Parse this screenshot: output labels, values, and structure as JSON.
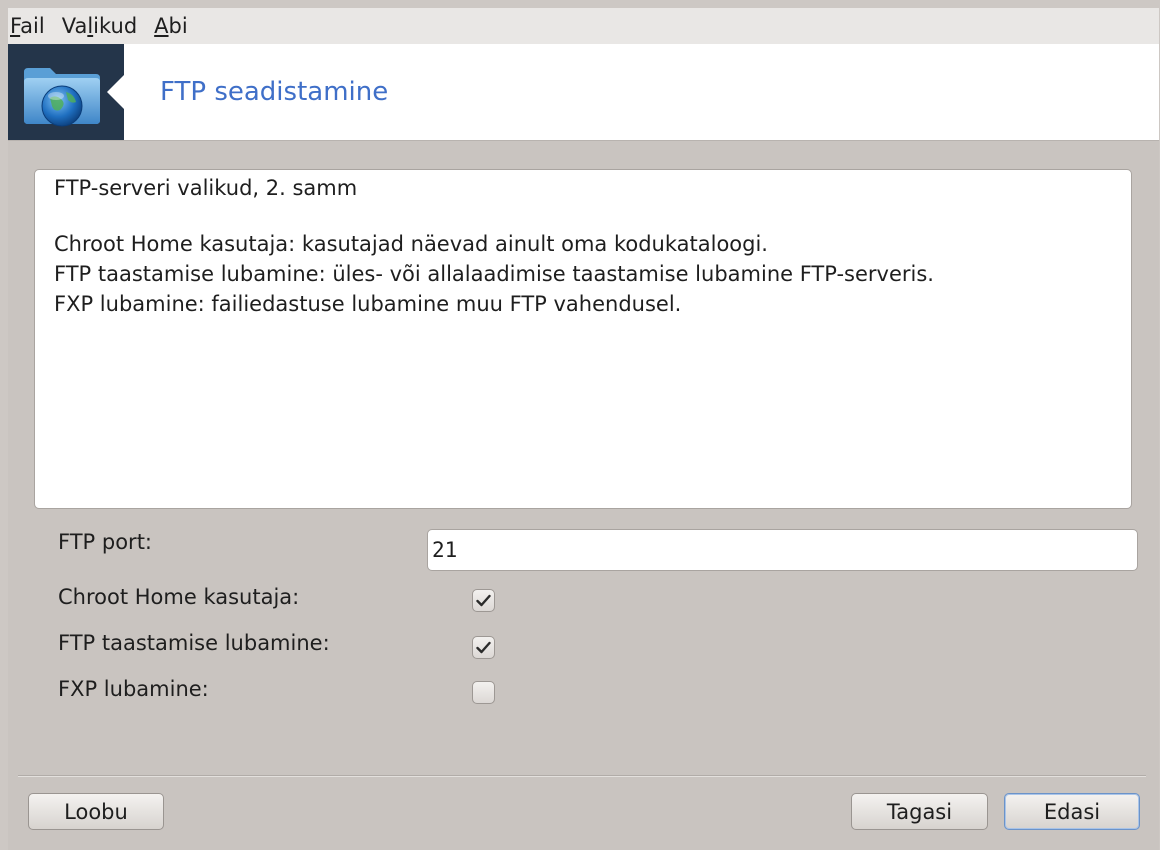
{
  "menubar": {
    "items": [
      {
        "mnemonic": "F",
        "rest": "ail"
      },
      {
        "pre": "Va",
        "mnemonic": "l",
        "rest": "ikud"
      },
      {
        "mnemonic": "A",
        "rest": "bi"
      }
    ]
  },
  "banner": {
    "title": "FTP seadistamine",
    "icon": "folder-globe-icon"
  },
  "description": {
    "lines": [
      "FTP-serveri valikud, 2. samm",
      "",
      "Chroot Home kasutaja: kasutajad näevad ainult oma kodukataloogi.",
      "FTP taastamise lubamine: üles- või allalaadimise taastamise lubamine FTP-serveris.",
      "FXP lubamine: failiedastuse lubamine muu FTP vahendusel."
    ]
  },
  "form": {
    "port_label": "FTP port:",
    "port_value": "21",
    "chroot_label": "Chroot Home kasutaja:",
    "chroot_checked": true,
    "resume_label": "FTP taastamise lubamine:",
    "resume_checked": true,
    "fxp_label": "FXP lubamine:",
    "fxp_checked": false
  },
  "buttons": {
    "cancel": "Loobu",
    "back": "Tagasi",
    "next": "Edasi"
  },
  "colors": {
    "accent_title": "#3f6fc8",
    "banner_icon_bg": "#24354a",
    "window_bg": "#c9c4c0"
  }
}
